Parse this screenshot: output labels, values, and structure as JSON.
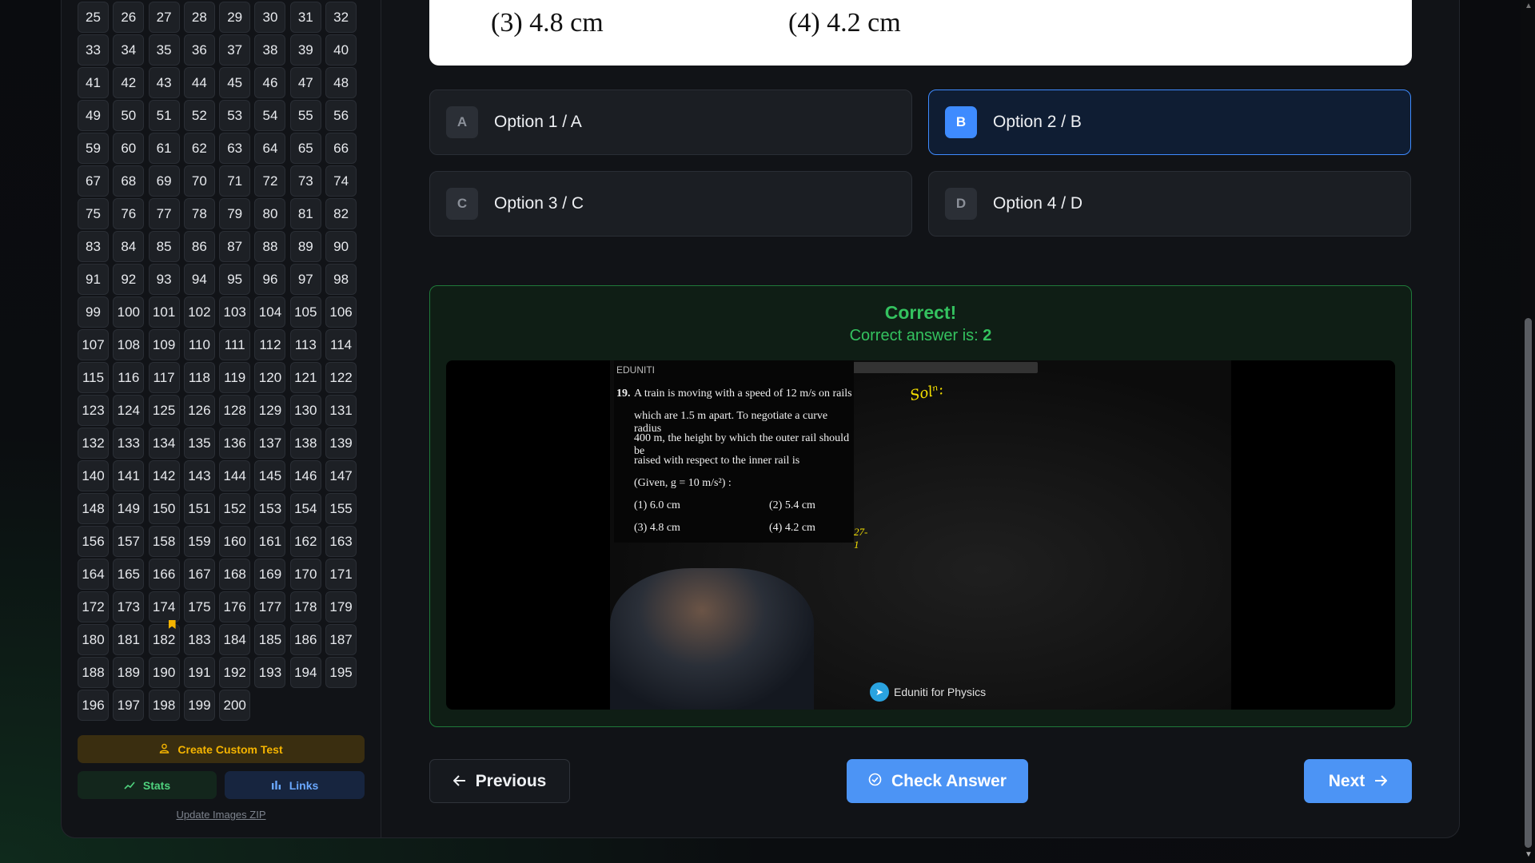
{
  "sidebar": {
    "question_numbers": [
      "25",
      "26",
      "27",
      "28",
      "29",
      "30",
      "31",
      "32",
      "33",
      "34",
      "35",
      "36",
      "37",
      "38",
      "39",
      "40",
      "41",
      "42",
      "43",
      "44",
      "45",
      "46",
      "47",
      "48",
      "49",
      "50",
      "51",
      "52",
      "53",
      "54",
      "55",
      "56",
      "59",
      "60",
      "61",
      "62",
      "63",
      "64",
      "65",
      "66",
      "67",
      "68",
      "69",
      "70",
      "71",
      "72",
      "73",
      "74",
      "75",
      "76",
      "77",
      "78",
      "79",
      "80",
      "81",
      "82",
      "83",
      "84",
      "85",
      "86",
      "87",
      "88",
      "89",
      "90",
      "91",
      "92",
      "93",
      "94",
      "95",
      "96",
      "97",
      "98",
      "99",
      "100",
      "101",
      "102",
      "103",
      "104",
      "105",
      "106",
      "107",
      "108",
      "109",
      "110",
      "111",
      "112",
      "113",
      "114",
      "115",
      "116",
      "117",
      "118",
      "119",
      "120",
      "121",
      "122",
      "123",
      "124",
      "125",
      "126",
      "128",
      "129",
      "130",
      "131",
      "132",
      "133",
      "134",
      "135",
      "136",
      "137",
      "138",
      "139",
      "140",
      "141",
      "142",
      "143",
      "144",
      "145",
      "146",
      "147",
      "148",
      "149",
      "150",
      "151",
      "152",
      "153",
      "154",
      "155",
      "156",
      "157",
      "158",
      "159",
      "160",
      "161",
      "162",
      "163",
      "164",
      "165",
      "166",
      "167",
      "168",
      "169",
      "170",
      "171",
      "172",
      "173",
      "174",
      "175",
      "176",
      "177",
      "178",
      "179",
      "180",
      "181",
      "182",
      "183",
      "184",
      "185",
      "186",
      "187",
      "188",
      "189",
      "190",
      "191",
      "192",
      "193",
      "194",
      "195",
      "196",
      "197",
      "198",
      "199",
      "200"
    ],
    "bookmarked": [
      "182"
    ],
    "create_custom_test": "Create Custom Test",
    "stats": "Stats",
    "links": "Links",
    "update_images_zip": "Update Images ZIP"
  },
  "question": {
    "option3_text": "(3) 4.8 cm",
    "option4_text": "(4) 4.2 cm"
  },
  "options": [
    {
      "letter": "A",
      "label": "Option 1 / A",
      "selected": false
    },
    {
      "letter": "B",
      "label": "Option 2 / B",
      "selected": true
    },
    {
      "letter": "C",
      "label": "Option 3 / C",
      "selected": false
    },
    {
      "letter": "D",
      "label": "Option 4 / D",
      "selected": false
    }
  ],
  "result": {
    "title": "Correct!",
    "subtitle_prefix": "Correct answer is: ",
    "answer": "2"
  },
  "video": {
    "brand": "EDUNITI",
    "question_number": "19.",
    "lines": [
      "A train is moving with a speed of 12 m/s on rails",
      "which are 1.5 m apart. To negotiate a curve radius",
      "400 m, the height by which the outer rail should be",
      "raised with respect to the inner rail is",
      "(Given, g = 10 m/s²) :"
    ],
    "opt1": "(1) 6.0 cm",
    "opt2": "(2) 5.4 cm",
    "opt3": "(3) 4.8 cm",
    "opt4": "(4) 4.2 cm",
    "handwritten_soln": "Solⁿ:",
    "handwritten_mark": "27-1",
    "channel": "Eduniti for Physics"
  },
  "nav": {
    "previous": "Previous",
    "check_answer": "Check Answer",
    "next": "Next"
  },
  "icons": {
    "create": "user-icon",
    "stats": "trend-icon",
    "links": "bar-chart-icon",
    "previous": "arrow-left-icon",
    "check": "check-circle-icon",
    "next": "arrow-right-icon"
  },
  "colors": {
    "accent": "#4c94f5",
    "success": "#34c25f",
    "warning": "#f5b400"
  }
}
